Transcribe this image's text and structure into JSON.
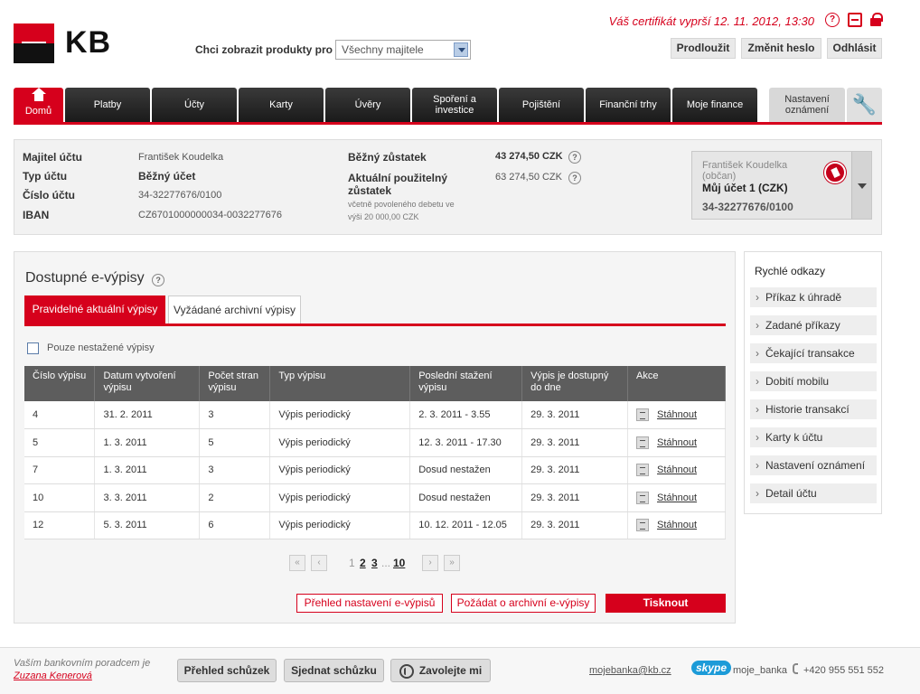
{
  "header": {
    "logo_text": "KB",
    "product_label": "Chci zobrazit produkty pro",
    "product_select_value": "Všechny majitele",
    "cert_notice": "Váš certifikát vyprší 12. 11. 2012, 13:30",
    "buttons": {
      "extend": "Prodloužit",
      "change_password": "Změnit heslo",
      "logout": "Odhlásit"
    }
  },
  "nav": {
    "home": "Domů",
    "items": [
      "Platby",
      "Účty",
      "Karty",
      "Úvěry",
      "Spoření a investice",
      "Pojištění",
      "Finanční trhy",
      "Moje finance"
    ],
    "settings": "Nastavení oznámení"
  },
  "account": {
    "labels": {
      "owner": "Majitel účtu",
      "type": "Typ účtu",
      "number": "Číslo účtu",
      "iban": "IBAN"
    },
    "values": {
      "owner": "František Koudelka",
      "type": "Běžný účet",
      "number": "34-32277676/0100",
      "iban": "CZ6701000000034-0032277676"
    },
    "balance_label": "Běžný zůstatek",
    "balance_value": "43 274,50 CZK",
    "available_label": "Aktuální použitelný zůstatek",
    "available_note": "včetně povoleného debetu ve výši 20 000,00 CZK",
    "available_value": "63 274,50 CZK",
    "card": {
      "owner": "František Koudelka (občan)",
      "account_name": "Můj účet 1 (CZK)",
      "number": "34-32277676/0100"
    }
  },
  "statements": {
    "title": "Dostupné e-výpisy",
    "tabs": [
      "Pravidelné aktuální výpisy",
      "Vyžádané archivní výpisy"
    ],
    "filter_label": "Pouze nestažené výpisy",
    "columns": [
      "Číslo výpisu",
      "Datum vytvoření výpisu",
      "Počet stran výpisu",
      "Typ výpisu",
      "Poslední stažení výpisu",
      "Výpis je dostupný do dne",
      "Akce"
    ],
    "rows": [
      [
        "4",
        "31. 2. 2011",
        "3",
        "Výpis periodický",
        "2. 3. 2011 - 3.55",
        "29. 3. 2011",
        "Stáhnout"
      ],
      [
        "5",
        "1. 3. 2011",
        "5",
        "Výpis periodický",
        "12. 3. 2011 - 17.30",
        "29. 3. 2011",
        "Stáhnout"
      ],
      [
        "7",
        "1. 3. 2011",
        "3",
        "Výpis periodický",
        "Dosud nestažen",
        "29. 3. 2011",
        "Stáhnout"
      ],
      [
        "10",
        "3. 3. 2011",
        "2",
        "Výpis periodický",
        "Dosud nestažen",
        "29. 3. 2011",
        "Stáhnout"
      ],
      [
        "12",
        "5. 3. 2011",
        "6",
        "Výpis periodický",
        "10. 12. 2011 - 12.05",
        "29. 3. 2011",
        "Stáhnout"
      ]
    ],
    "pager": {
      "pages": [
        "1",
        "2",
        "3",
        "10"
      ],
      "ellipsis": "..."
    },
    "actions": {
      "overview": "Přehled nastavení e-výpisů",
      "request": "Požádat o archivní e-výpisy",
      "print": "Tisknout"
    }
  },
  "quick_links": {
    "title": "Rychlé odkazy",
    "items": [
      "Příkaz k úhradě",
      "Zadané příkazy",
      "Čekající transakce",
      "Dobití mobilu",
      "Historie transakcí",
      "Karty k účtu",
      "Nastavení oznámení",
      "Detail účtu"
    ]
  },
  "footer": {
    "advisor_text": "Vaším bankovním poradcem je",
    "advisor_name": "Zuzana Kenerová",
    "buttons": {
      "meetings": "Přehled schůzek",
      "schedule": "Sjednat schůzku",
      "call_me": "Zavolejte mi"
    },
    "email": "mojebanka@kb.cz",
    "skype_logo": "skype",
    "skype": "moje_banka",
    "phone": "+420 955 551 552"
  }
}
